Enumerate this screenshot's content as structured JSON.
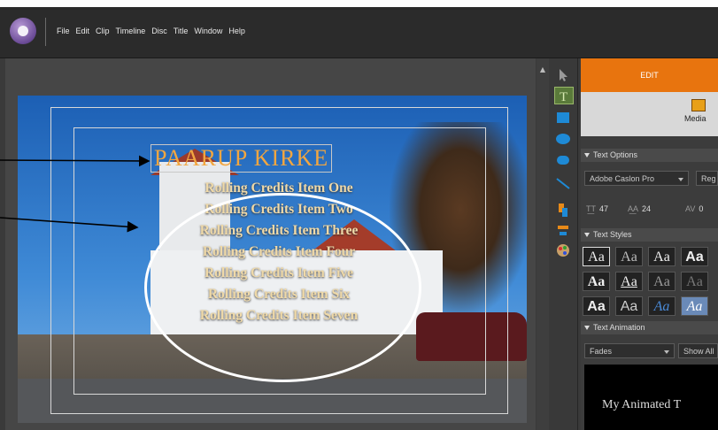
{
  "menu": {
    "items": [
      "File",
      "Edit",
      "Clip",
      "Timeline",
      "Disc",
      "Title",
      "Window",
      "Help"
    ]
  },
  "viewer": {
    "title_text": "PAARUP KIRKE",
    "credits": [
      "Rolling Credits Item One",
      "Rolling Credits Item Two",
      "Rolling Credits Item Three",
      "Rolling Credits Item Four",
      "Rolling Credits Item Five",
      "Rolling Credits Item Six",
      "Rolling Credits Item Seven"
    ]
  },
  "tools": [
    "selection-tool",
    "text-tool",
    "rectangle-tool",
    "ellipse-tool",
    "rounded-rectangle-tool",
    "line-tool",
    "arrange-tool",
    "align-tool",
    "color-tool"
  ],
  "panel": {
    "edit_tab": "EDIT",
    "media_label": "Media",
    "text_options": {
      "header": "Text Options",
      "font": "Adobe Caslon Pro",
      "style": "Reg",
      "size_value": "47",
      "leading_value": "24",
      "kerning_value": "0"
    },
    "text_styles": {
      "header": "Text Styles",
      "swatch_label": "Aa"
    },
    "text_animation": {
      "header": "Text Animation",
      "category": "Fades",
      "show_all": "Show All",
      "preview_text": "My Animated T"
    }
  },
  "colors": {
    "accent_orange": "#e8740e",
    "title_gold": "#f2a640",
    "credit_cream": "#efd9a8"
  }
}
